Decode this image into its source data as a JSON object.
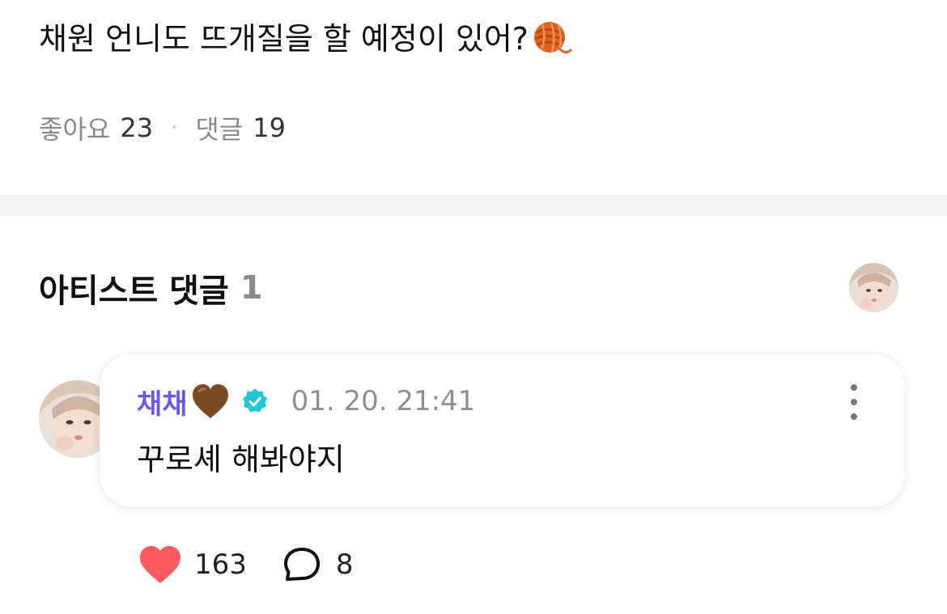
{
  "post": {
    "text": "채원 언니도 뜨개질을 할 예정이 있어?",
    "likes_label": "좋아요",
    "likes_count": "23",
    "separator": "·",
    "comments_label": "댓글",
    "comments_count": "19"
  },
  "artist_comments": {
    "title": "아티스트 댓글",
    "count": "1"
  },
  "comment": {
    "author": "채채",
    "timestamp": "01. 20. 21:41",
    "body": "꾸로셰 해봐야지",
    "like_count": "163",
    "reply_count": "8"
  },
  "colors": {
    "author": "#6b55f2",
    "verified": "#1fc7d4",
    "like_heart": "#ff5a5f",
    "brown_heart": "#7a4a22",
    "yarn": "#e0621f",
    "divider": "#f4f4f4"
  },
  "icons": [
    "yarn-icon",
    "brown-heart-icon",
    "verified-icon",
    "more-icon",
    "heart-icon",
    "speech-bubble-icon"
  ]
}
